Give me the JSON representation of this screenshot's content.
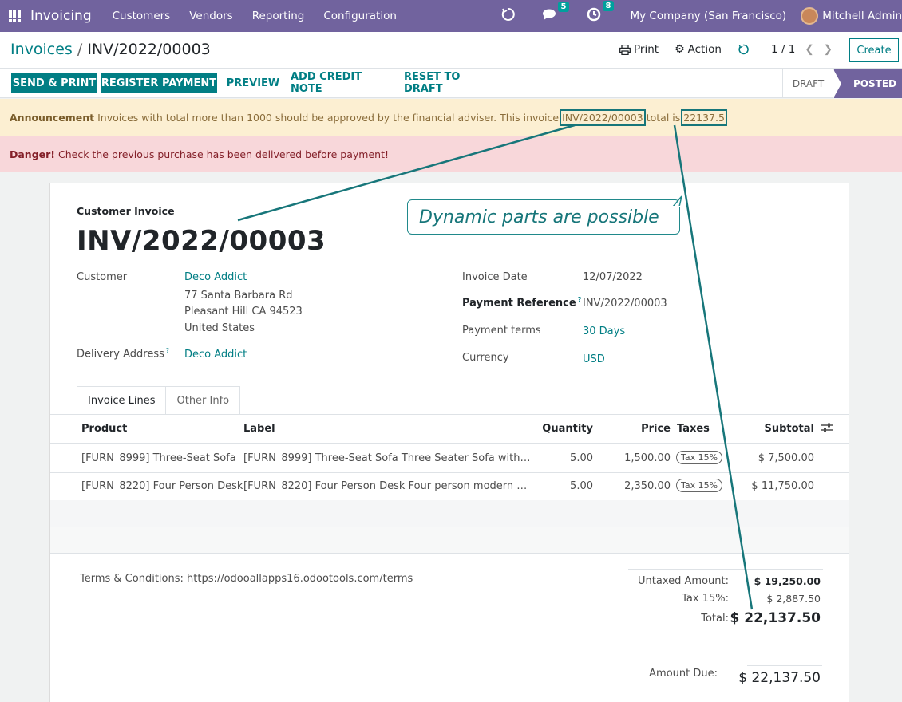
{
  "navbar": {
    "app_name": "Invoicing",
    "menus": [
      "Customers",
      "Vendors",
      "Reporting",
      "Configuration"
    ],
    "messages_count": "5",
    "activities_count": "8",
    "company": "My Company (San Francisco)",
    "user": "Mitchell Admin"
  },
  "control_panel": {
    "breadcrumb_parent": "Invoices",
    "breadcrumb_sep": "/",
    "breadcrumb_current": "INV/2022/00003",
    "print_label": "Print",
    "action_label": "Action",
    "pager_value": "1 / 1",
    "create_label": "Create"
  },
  "statusbar": {
    "buttons": [
      "SEND & PRINT",
      "REGISTER PAYMENT",
      "PREVIEW",
      "ADD CREDIT NOTE",
      "RESET TO DRAFT"
    ],
    "states": [
      "DRAFT",
      "POSTED"
    ],
    "active_state": "POSTED"
  },
  "announcement": {
    "title": "Announcement",
    "text_before": "Invoices with total more than 1000 should be approved by the financial adviser. This invoice",
    "invoice_ref": "INV/2022/00003",
    "text_middle": "total is",
    "total_value": "22137.5"
  },
  "danger": {
    "title": "Danger!",
    "text": "Check the previous purchase has been delivered before payment!"
  },
  "callout": {
    "text": "Dynamic parts are possible"
  },
  "invoice": {
    "type_label": "Customer Invoice",
    "number": "INV/2022/00003",
    "customer_label": "Customer",
    "customer_name": "Deco Addict",
    "address_line1": "77 Santa Barbara Rd",
    "address_line2": "Pleasant Hill CA 94523",
    "address_line3": "United States",
    "delivery_label": "Delivery Address",
    "delivery_value": "Deco Addict",
    "invoice_date_label": "Invoice Date",
    "invoice_date": "12/07/2022",
    "payment_ref_label": "Payment Reference",
    "payment_ref": "INV/2022/00003",
    "payment_terms_label": "Payment terms",
    "payment_terms": "30 Days",
    "currency_label": "Currency",
    "currency": "USD",
    "help_mark": "?"
  },
  "tabs": [
    "Invoice Lines",
    "Other Info"
  ],
  "lines": {
    "headers": {
      "product": "Product",
      "label": "Label",
      "quantity": "Quantity",
      "price": "Price",
      "taxes": "Taxes",
      "subtotal": "Subtotal"
    },
    "rows": [
      {
        "product": "[FURN_8999] Three-Seat Sofa",
        "label": "[FURN_8999] Three-Seat Sofa Three Seater Sofa with…",
        "quantity": "5.00",
        "price": "1,500.00",
        "tax": "Tax 15%",
        "subtotal": "$ 7,500.00"
      },
      {
        "product": "[FURN_8220] Four Person Desk",
        "label": "[FURN_8220] Four Person Desk Four person modern …",
        "quantity": "5.00",
        "price": "2,350.00",
        "tax": "Tax 15%",
        "subtotal": "$ 11,750.00"
      }
    ]
  },
  "footer": {
    "terms": "Terms & Conditions: https://odooallapps16.odootools.com/terms",
    "untaxed_label": "Untaxed Amount:",
    "untaxed_value": "$ 19,250.00",
    "tax_label": "Tax 15%:",
    "tax_value": "$ 2,887.50",
    "total_label": "Total:",
    "total_value": "$ 22,137.50",
    "amount_due_label": "Amount Due:",
    "amount_due_value": "$ 22,137.50"
  },
  "colors": {
    "brand": "#71639e",
    "accent": "#017e84",
    "warning_bg": "#fcefd2",
    "danger_bg": "#f8d7da",
    "annotation": "#17767a"
  }
}
